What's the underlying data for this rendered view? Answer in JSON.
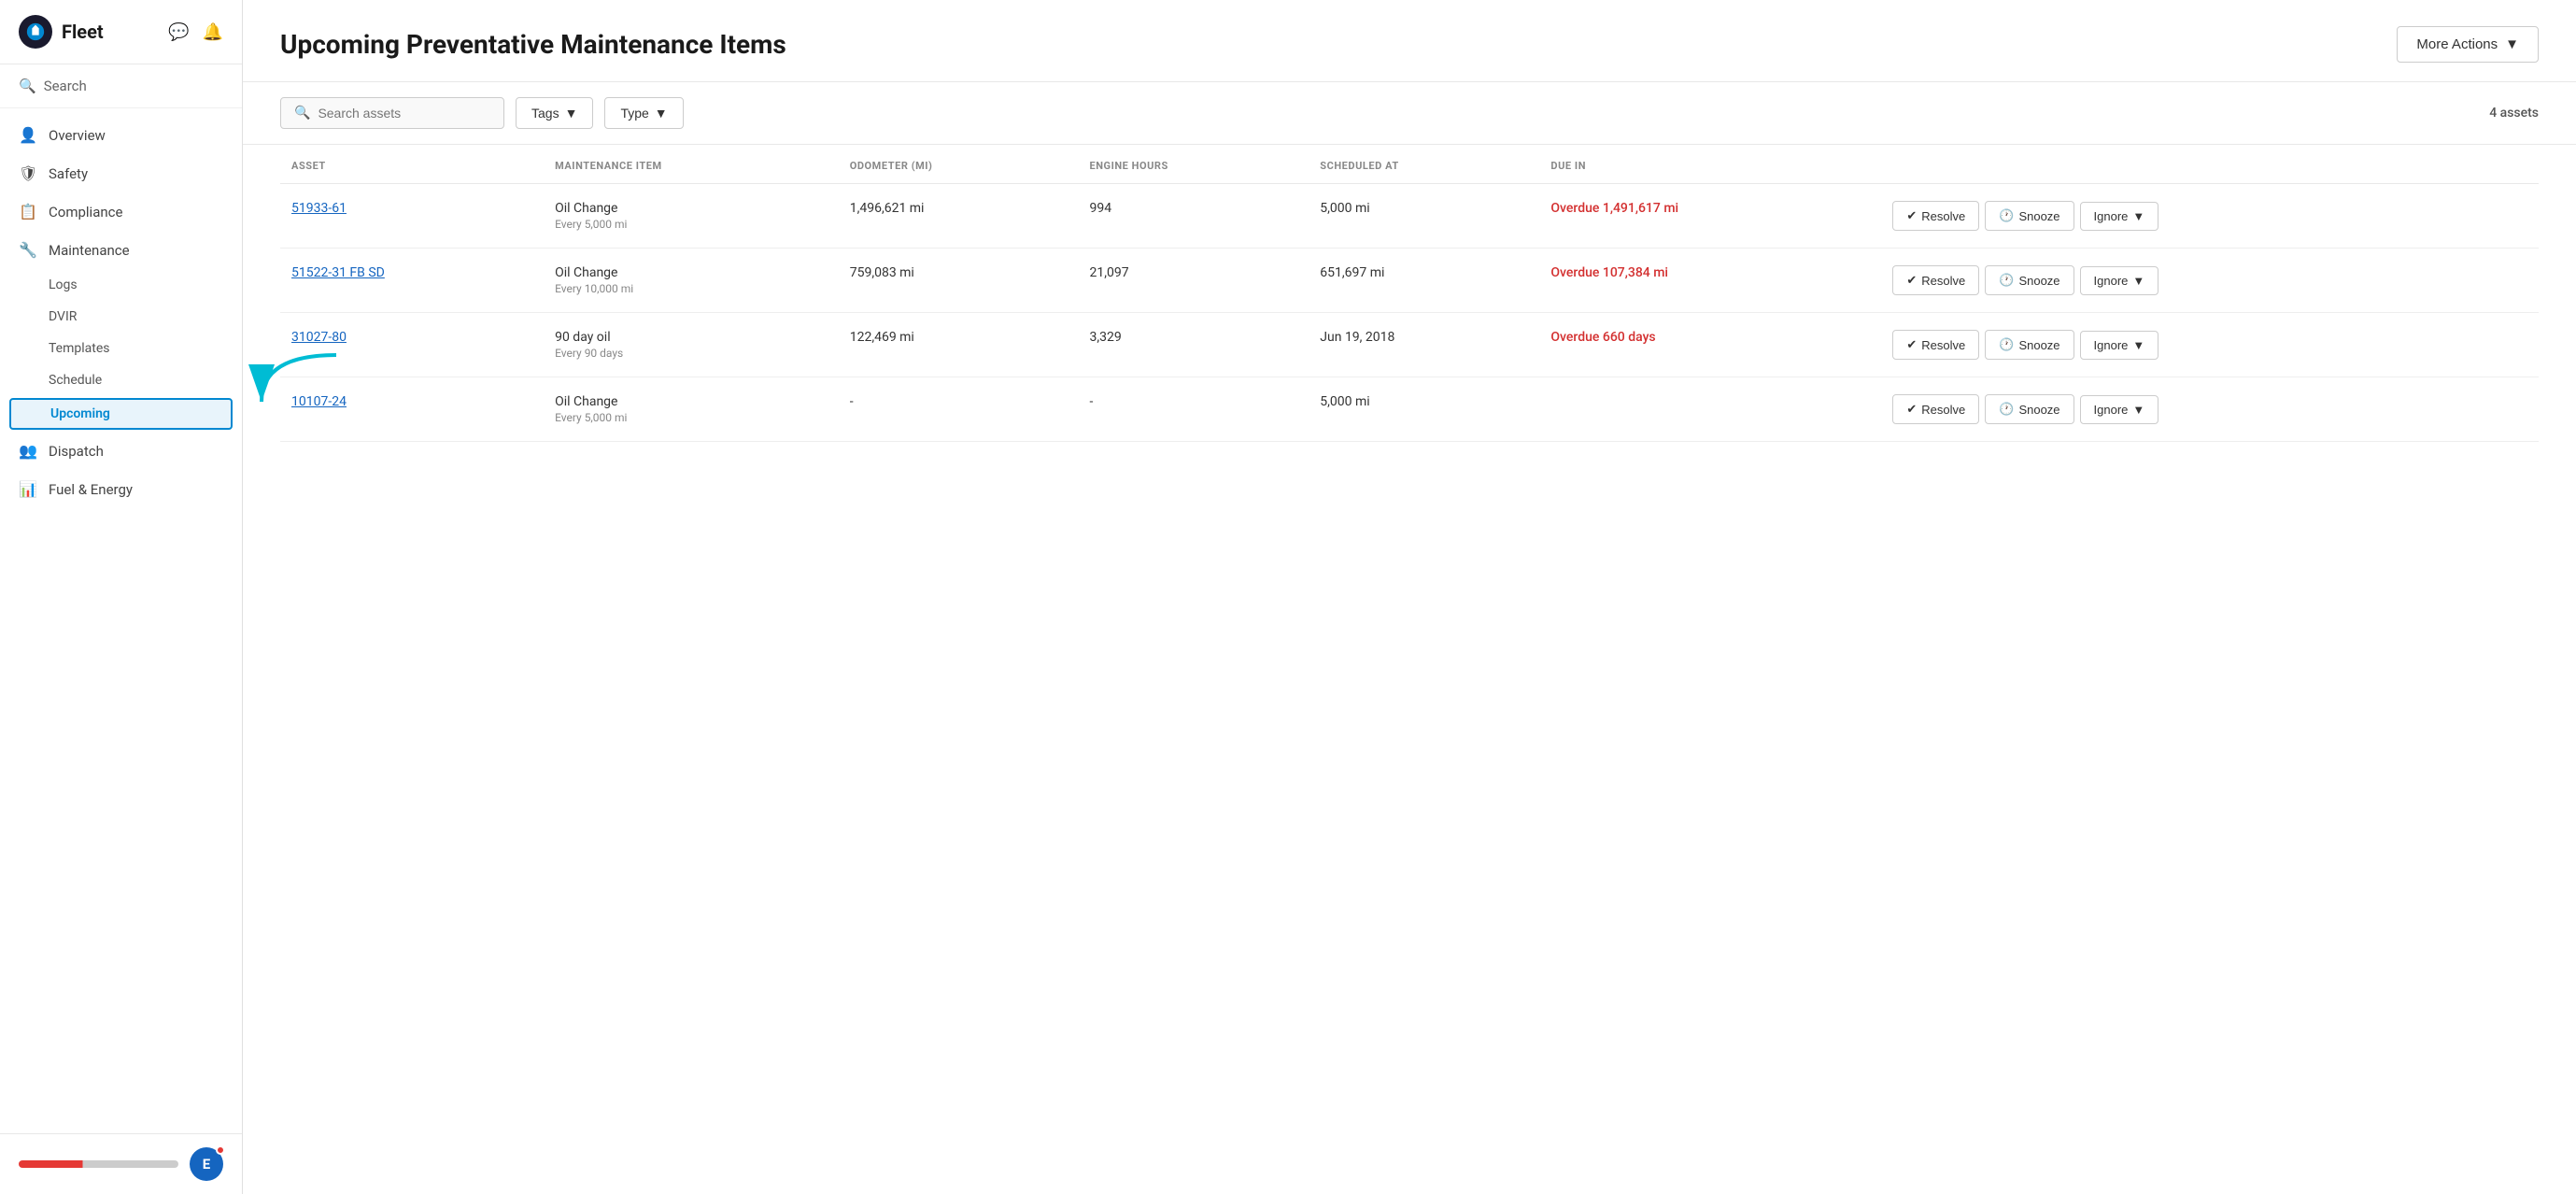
{
  "app": {
    "title": "Fleet"
  },
  "sidebar": {
    "search_label": "Search",
    "nav_items": [
      {
        "id": "overview",
        "label": "Overview",
        "icon": "👤"
      },
      {
        "id": "safety",
        "label": "Safety",
        "icon": "🛡"
      },
      {
        "id": "compliance",
        "label": "Compliance",
        "icon": "📋"
      },
      {
        "id": "maintenance",
        "label": "Maintenance",
        "icon": "🔧",
        "active": false
      },
      {
        "id": "dispatch",
        "label": "Dispatch",
        "icon": "👥"
      },
      {
        "id": "fuel-energy",
        "label": "Fuel & Energy",
        "icon": "📊"
      }
    ],
    "sub_items": [
      {
        "id": "logs",
        "label": "Logs"
      },
      {
        "id": "dvir",
        "label": "DVIR"
      },
      {
        "id": "templates",
        "label": "Templates"
      },
      {
        "id": "schedule",
        "label": "Schedule"
      },
      {
        "id": "upcoming",
        "label": "Upcoming",
        "active": true
      }
    ],
    "avatar_label": "E"
  },
  "header": {
    "title": "Upcoming Preventative Maintenance Items",
    "more_actions": "More Actions"
  },
  "toolbar": {
    "search_placeholder": "Search assets",
    "tags_label": "Tags",
    "type_label": "Type",
    "asset_count": "4 assets"
  },
  "table": {
    "columns": [
      {
        "id": "asset",
        "label": "ASSET"
      },
      {
        "id": "maintenance_item",
        "label": "MAINTENANCE ITEM"
      },
      {
        "id": "odometer",
        "label": "ODOMETER (MI)"
      },
      {
        "id": "engine_hours",
        "label": "ENGINE HOURS"
      },
      {
        "id": "scheduled_at",
        "label": "SCHEDULED AT"
      },
      {
        "id": "due_in",
        "label": "DUE IN"
      }
    ],
    "rows": [
      {
        "asset": "51933-61",
        "maintenance_name": "Oil Change",
        "maintenance_freq": "Every 5,000 mi",
        "odometer": "1,496,621 mi",
        "engine_hours": "994",
        "scheduled_at": "5,000 mi",
        "due_in": "Overdue 1,491,617 mi",
        "overdue": true
      },
      {
        "asset": "51522-31 FB SD",
        "maintenance_name": "Oil Change",
        "maintenance_freq": "Every 10,000 mi",
        "odometer": "759,083 mi",
        "engine_hours": "21,097",
        "scheduled_at": "651,697 mi",
        "due_in": "Overdue 107,384 mi",
        "overdue": true
      },
      {
        "asset": "31027-80",
        "maintenance_name": "90 day oil",
        "maintenance_freq": "Every 90 days",
        "odometer": "122,469 mi",
        "engine_hours": "3,329",
        "scheduled_at": "Jun 19, 2018",
        "due_in": "Overdue 660 days",
        "overdue": true
      },
      {
        "asset": "10107-24",
        "maintenance_name": "Oil Change",
        "maintenance_freq": "Every 5,000 mi",
        "odometer": "-",
        "engine_hours": "-",
        "scheduled_at": "5,000 mi",
        "due_in": "",
        "overdue": false
      }
    ],
    "buttons": {
      "resolve": "Resolve",
      "snooze": "Snooze",
      "ignore": "Ignore"
    }
  }
}
